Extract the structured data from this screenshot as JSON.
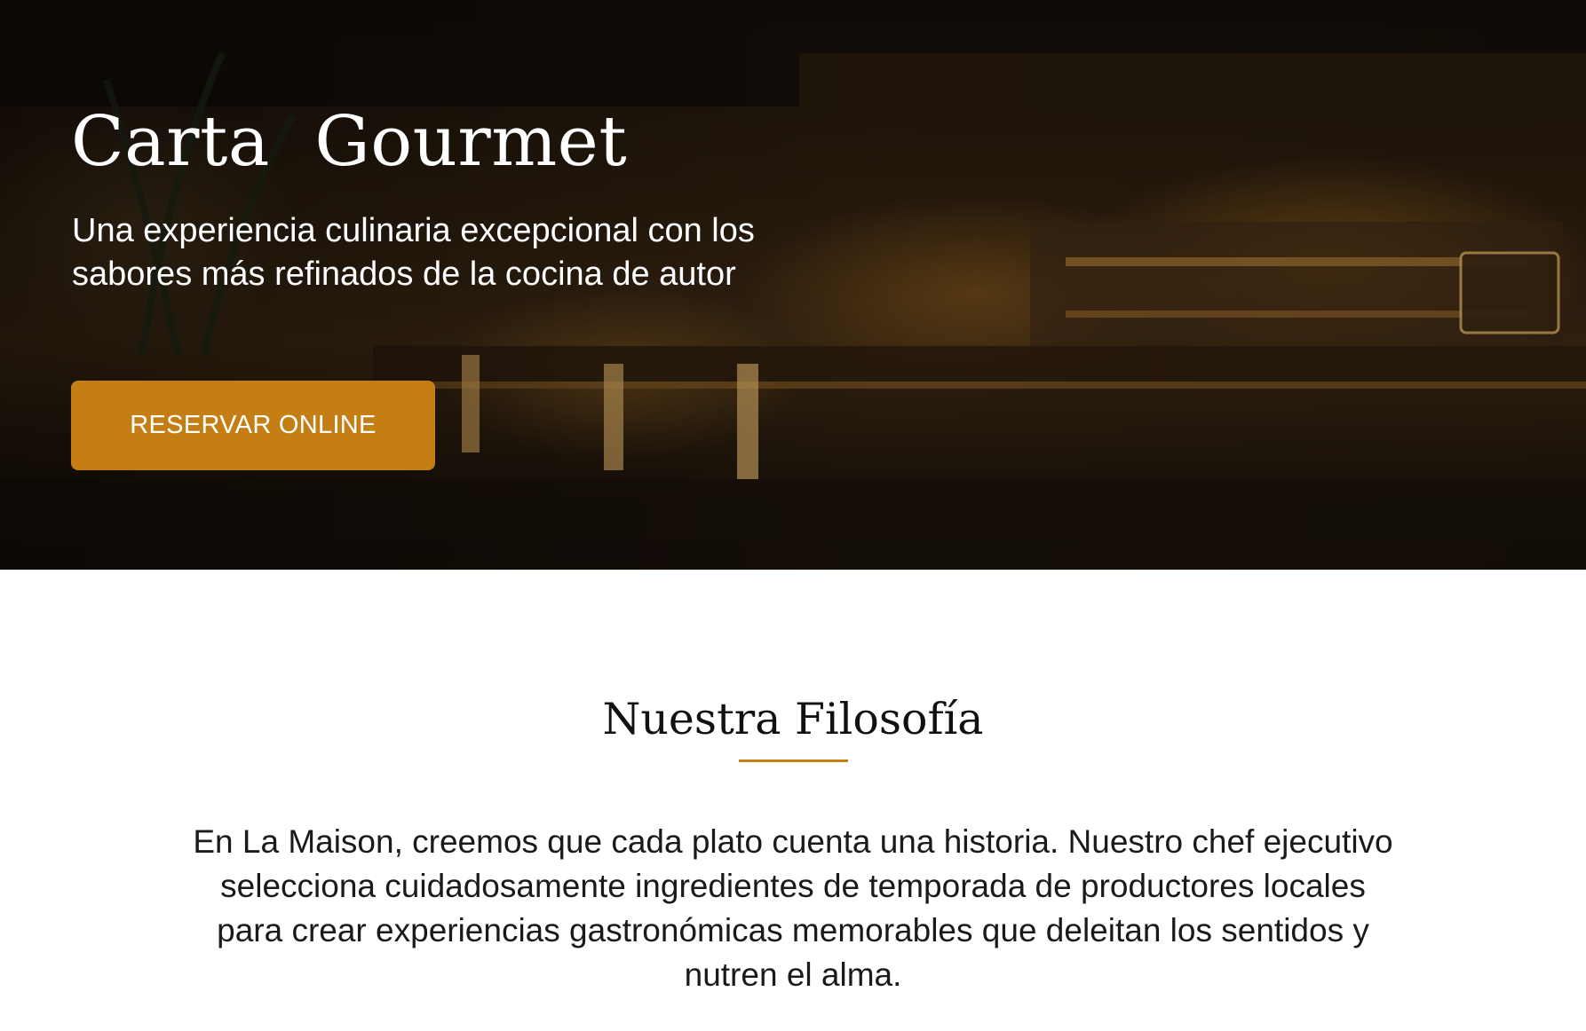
{
  "hero": {
    "title": "Carta  Gourmet",
    "subtitle": "Una experiencia culinaria excepcional con los sabores más refinados de la cocina de autor",
    "reserve_label": "RESERVAR ONLINE"
  },
  "philosophy": {
    "title": "Nuestra Filosofía",
    "text": "En La Maison, creemos que cada plato cuenta una historia. Nuestro chef ejecutivo selecciona cuidadosamente ingredientes de temporada de productores locales para crear experiencias gastronómicas memorables que deleitan los sentidos y nutren el alma."
  },
  "colors": {
    "accent": "#c57e14",
    "text_dark": "#1a1a1a",
    "hero_text": "#ffffff"
  }
}
